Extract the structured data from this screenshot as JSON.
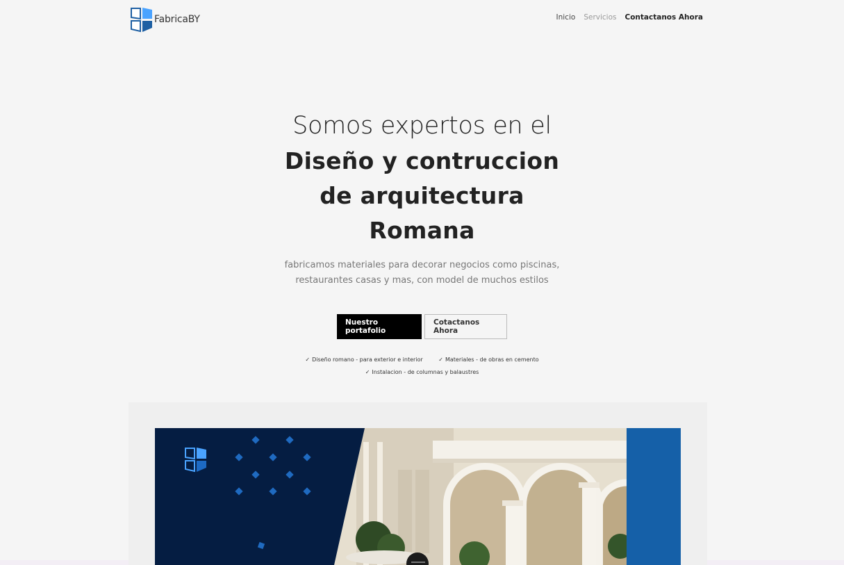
{
  "brand": {
    "name": "FabricaBY",
    "logo_icon": "cube-logo-icon"
  },
  "nav": {
    "items": [
      {
        "label": "Inicio",
        "state": "normal"
      },
      {
        "label": "Servicios",
        "state": "muted"
      },
      {
        "label": "Contactanos Ahora",
        "state": "bold"
      }
    ]
  },
  "hero": {
    "title_light": "Somos expertos en el",
    "title_bold_lines": [
      "Diseño y contruccion",
      "de arquitectura",
      "Romana"
    ],
    "subtitle_lines": [
      "fabricamos materiales para decorar negocios como piscinas,",
      "restaurantes casas y mas, con model de muchos estilos"
    ],
    "primary_button": "Nuestro portafolio",
    "secondary_button": "Cotactanos Ahora",
    "features": [
      "Diseño romano - para exterior e interior",
      "Materiales - de obras en cemento",
      "Instalacion - de columnas y balaustres"
    ],
    "check_icon": "✓"
  },
  "colors": {
    "background": "#f5f5f5",
    "primary": "#000000",
    "navy": "#051d42",
    "accent_blue": "#1560a8",
    "logo_blue": "#4aa3ff"
  }
}
